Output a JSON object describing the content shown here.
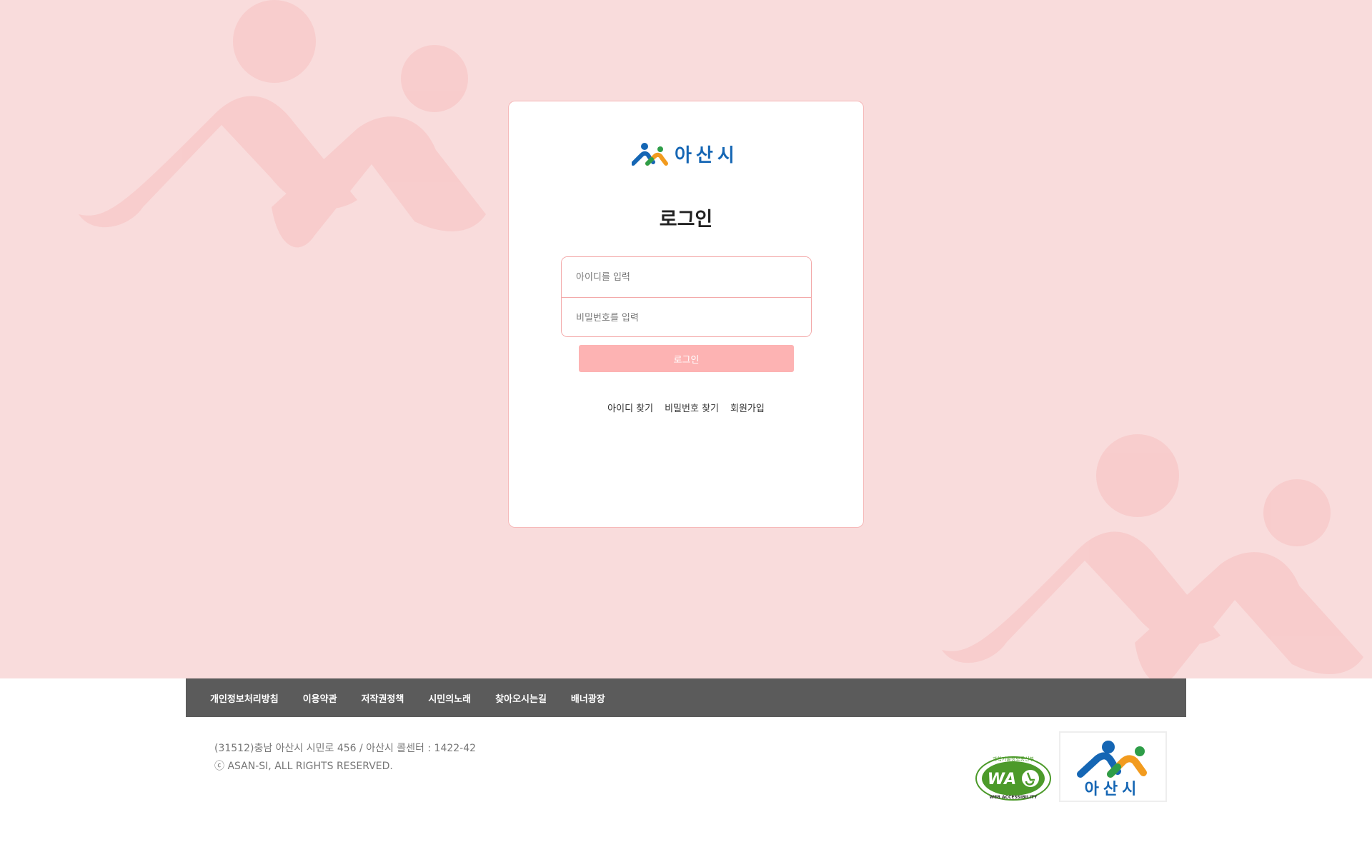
{
  "brand": {
    "name": "아산시"
  },
  "login": {
    "title": "로그인",
    "id_placeholder": "아이디를 입력",
    "pw_placeholder": "비밀번호를 입력",
    "button": "로그인",
    "links": [
      "아이디 찾기",
      "비밀번호 찾기",
      "회원가입"
    ]
  },
  "footer": {
    "nav": [
      "개인정보처리방침",
      "이용약관",
      "저작권정책",
      "시민의노래",
      "찾아오시는길",
      "배너광장"
    ],
    "address": "(31512)충남 아산시 시민로 456 / 아산시 콜센터 : 1422-42",
    "copyright": "ⓒ ASAN-SI, ALL RIGHTS RESERVED.",
    "wa_mark": "WA",
    "wa_caption": "WEB ACCESSIBILITY",
    "wa_top": "과학기술정보통신부",
    "logo_name": "아산시"
  },
  "colors": {
    "background": "#f9dcdc",
    "decoration": "#f8c8c8",
    "accent": "#fdb3b3",
    "brand_blue": "#1566b4",
    "brand_green": "#2e9d48",
    "brand_orange": "#f29b1e",
    "footer_bar": "#5b5b5b"
  },
  "icons": {
    "logo": "asan-logo-icon",
    "wa": "wa-certification-icon"
  }
}
